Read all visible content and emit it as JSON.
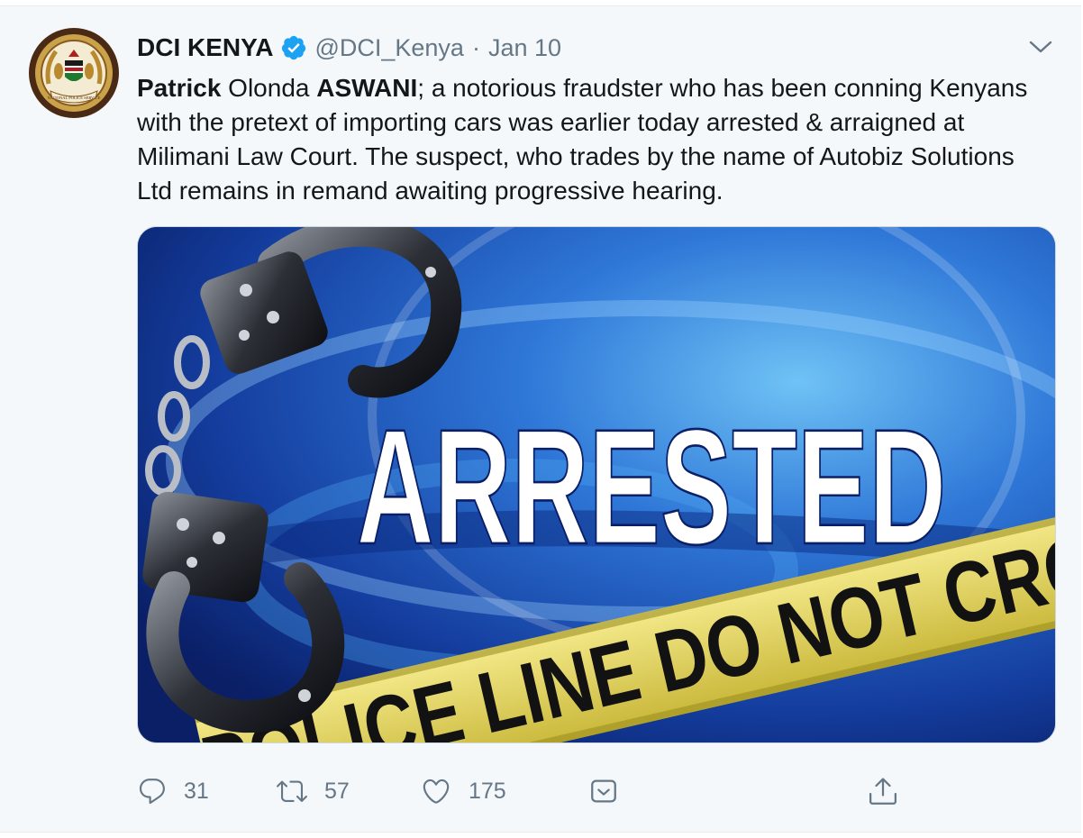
{
  "tweet": {
    "display_name": "DCI KENYA",
    "handle": "@DCI_Kenya",
    "separator": "·",
    "date": "Jan 10",
    "text": {
      "bold1": "Patrick",
      "part1": " Olonda ",
      "bold2": "ASWANI",
      "part2": "; a notorious fraudster who has been conning Kenyans with the pretext of importing cars was earlier today arrested & arraigned at Milimani Law Court. The suspect, who trades by the name of Autobiz Solutions Ltd remains in remand awaiting progressive hearing."
    },
    "avatar_seal_text": "NATIONAL POLICE SERVICE",
    "media": {
      "headline": "ARRESTED",
      "tape_text": "POLICE LINE DO NOT CROSS"
    },
    "actions": {
      "replies": "31",
      "retweets": "57",
      "likes": "175"
    }
  },
  "colors": {
    "text_primary": "#14171a",
    "text_secondary": "#657786",
    "verified_blue": "#1da1f2",
    "tweet_background": "#f5f8fa"
  },
  "icons": [
    "verified-icon",
    "chevron-down-icon",
    "reply-icon",
    "retweet-icon",
    "like-icon",
    "dm-icon",
    "share-icon"
  ]
}
